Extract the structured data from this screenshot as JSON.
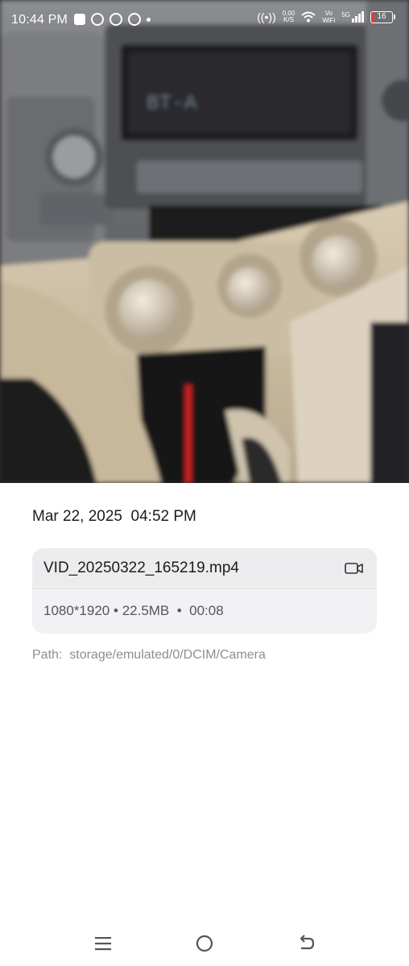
{
  "status_bar": {
    "time": "10:44 PM",
    "notifications": [
      "app-square-icon",
      "whatsapp-icon",
      "whatsapp-business-icon",
      "messenger-icon",
      "more-dot-icon"
    ],
    "hotspot_icon": "hotspot-icon",
    "net_speed_value": "0.00",
    "net_speed_unit": "K/S",
    "vowifi_top": "Vo",
    "vowifi_bottom": "WiFi",
    "network_type": "5G",
    "battery_level": "16",
    "battery_color": "#e53935"
  },
  "preview": {
    "description_icon": "video-thumbnail",
    "display_text": "BT-A"
  },
  "details": {
    "date": "Mar 22, 2025",
    "time": "04:52 PM",
    "file_name": "VID_20250322_165219.mp4",
    "resolution": "1080*1920",
    "size": "22.5MB",
    "duration": "00:08",
    "meta_separator": "•",
    "path_label": "Path:",
    "path_value": "storage/emulated/0/DCIM/Camera",
    "file_type_icon": "video-camera-icon"
  },
  "nav_bar": {
    "recents_icon": "menu-icon",
    "home_icon": "home-circle-icon",
    "back_icon": "back-icon"
  },
  "colors": {
    "background": "#ffffff",
    "card": "#f2f2f4",
    "primary_text": "#1c1c1c",
    "secondary_text": "#8e8e93"
  }
}
